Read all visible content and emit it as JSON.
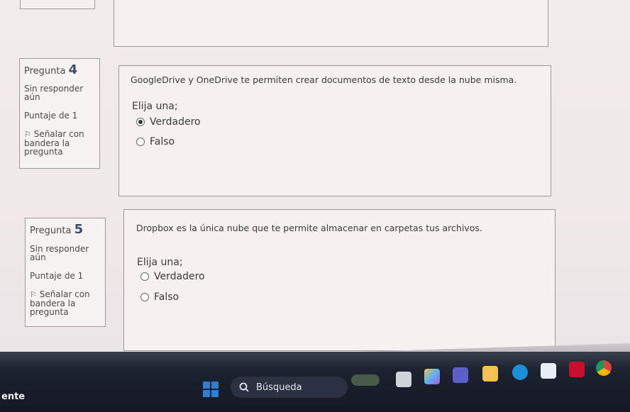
{
  "question4": {
    "label": "Pregunta",
    "number": "4",
    "status": "Sin responder aún",
    "score": "Puntaje de 1",
    "flag": "Señalar con bandera la pregunta",
    "text": "GoogleDrive y OneDrive te permiten crear documentos de texto desde la nube misma.",
    "prompt": "Elija una;",
    "options": [
      "Verdadero",
      "Falso"
    ],
    "selected": "Verdadero"
  },
  "question5": {
    "label": "Pregunta",
    "number": "5",
    "status": "Sin responder aún",
    "score": "Puntaje de 1",
    "flag": "Señalar con bandera la pregunta",
    "text": "Dropbox es la única nube que te permite almacenar en carpetas tus archivos.",
    "prompt": "Elija una;",
    "options": [
      "Verdadero",
      "Falso"
    ],
    "selected": ""
  },
  "taskbar": {
    "left_text": "ente",
    "search_label": "Búsqueda"
  },
  "colors": {
    "start": "#2d7fd6",
    "edge": "#1b8fd8",
    "mcafee": "#c8102e"
  },
  "icons": [
    "windows-start-icon",
    "search-icon",
    "file-explorer-icon",
    "edge-icon",
    "teams-icon",
    "store-icon",
    "chrome-icon"
  ]
}
